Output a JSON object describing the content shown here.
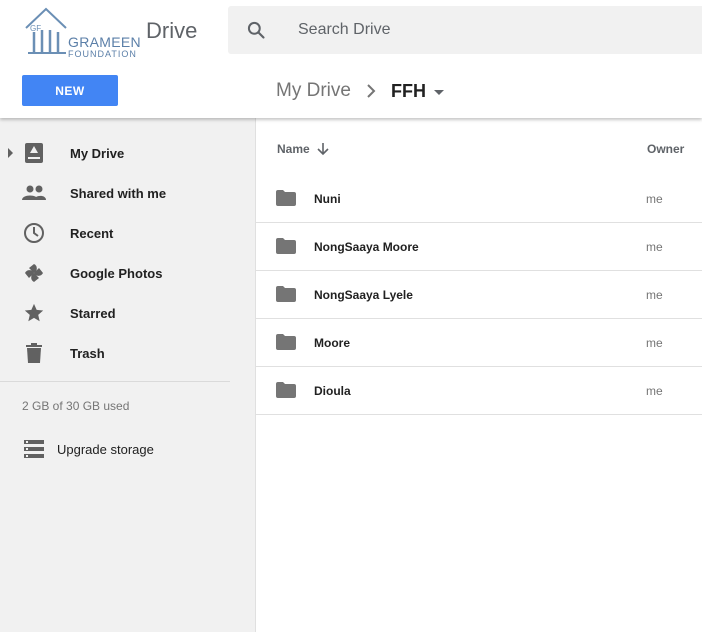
{
  "header": {
    "logo_line1": "GRAMEEN",
    "logo_line2": "FOUNDATION",
    "logo_initials": "GF",
    "app_name": "Drive",
    "search_placeholder": "Search Drive",
    "new_button": "NEW"
  },
  "breadcrumb": {
    "root": "My Drive",
    "current": "FFH"
  },
  "sidebar": {
    "items": [
      {
        "label": "My Drive",
        "icon": "drive-icon"
      },
      {
        "label": "Shared with me",
        "icon": "people-icon"
      },
      {
        "label": "Recent",
        "icon": "clock-icon"
      },
      {
        "label": "Google Photos",
        "icon": "pinwheel-icon"
      },
      {
        "label": "Starred",
        "icon": "star-icon"
      },
      {
        "label": "Trash",
        "icon": "trash-icon"
      }
    ],
    "storage": "2 GB of 30 GB used",
    "upgrade": "Upgrade storage"
  },
  "list": {
    "columns": {
      "name": "Name",
      "owner": "Owner"
    },
    "rows": [
      {
        "name": "Nuni",
        "owner": "me"
      },
      {
        "name": "NongSaaya Moore",
        "owner": "me"
      },
      {
        "name": "NongSaaya Lyele",
        "owner": "me"
      },
      {
        "name": "Moore",
        "owner": "me"
      },
      {
        "name": "Dioula",
        "owner": "me"
      }
    ]
  },
  "colors": {
    "accent": "#4285f4",
    "sidebar_bg": "#f1f1f1",
    "icon_gray": "#757575"
  }
}
